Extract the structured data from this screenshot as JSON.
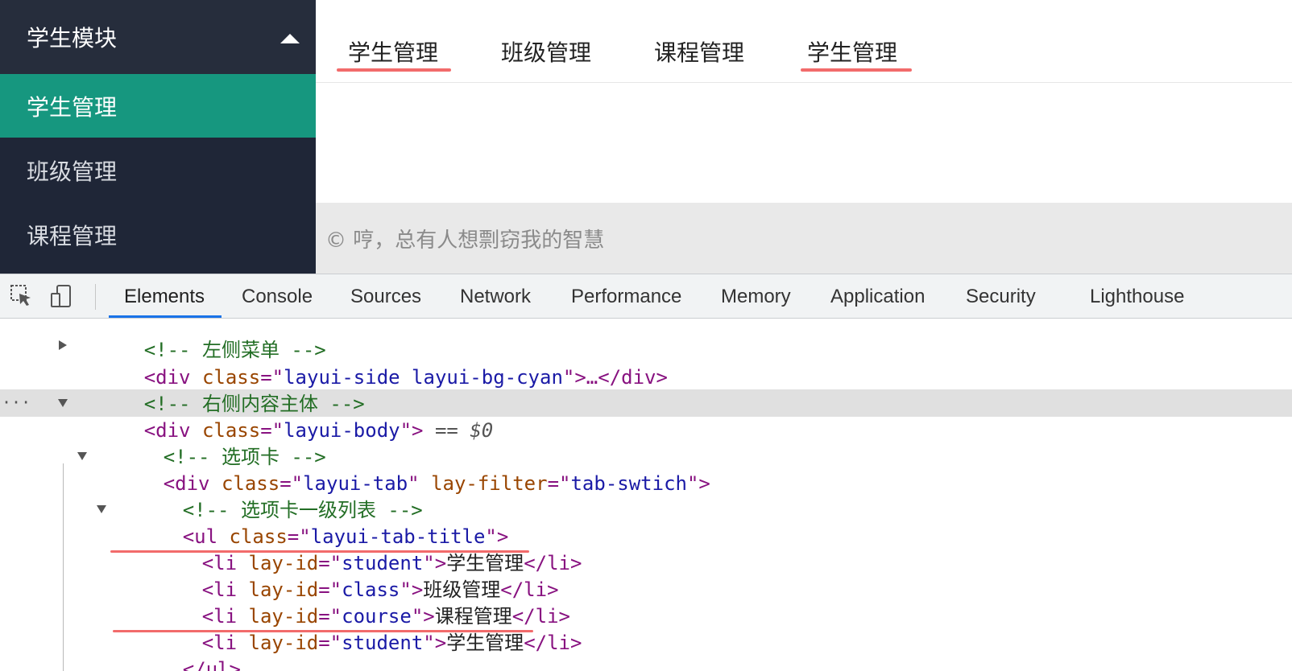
{
  "sidebar": {
    "module_title": "学生模块",
    "items": [
      {
        "label": "学生管理",
        "active": true
      },
      {
        "label": "班级管理",
        "active": false
      },
      {
        "label": "课程管理",
        "active": false
      }
    ]
  },
  "tabs": [
    {
      "label": "学生管理",
      "underlined": true
    },
    {
      "label": "班级管理",
      "underlined": false
    },
    {
      "label": "课程管理",
      "underlined": false
    },
    {
      "label": "学生管理",
      "underlined": true
    }
  ],
  "footer": {
    "text": "© 哼，总有人想剽窃我的智慧"
  },
  "devtools": {
    "tabs": [
      "Elements",
      "Console",
      "Sources",
      "Network",
      "Performance",
      "Memory",
      "Application",
      "Security",
      "Lighthouse"
    ],
    "active_tab": "Elements",
    "code": {
      "l0_comment": "<!-- 左侧菜单 -->",
      "l1_tag_open": "<div",
      "l1_attr": "class",
      "l1_eq": "=\"",
      "l1_val": "layui-side layui-bg-cyan",
      "l1_close": "\">…</div>",
      "l2_comment": "<!-- 右侧内容主体 -->",
      "l3_tag_open": "<div",
      "l3_attr": "class",
      "l3_eq": "=\"",
      "l3_val": "layui-body",
      "l3_close": "\">",
      "l3_marker": " == $0",
      "l4_comment": "<!-- 选项卡 -->",
      "l5_tag_open": "<div",
      "l5_attr1": "class",
      "l5_val1": "layui-tab",
      "l5_attr2": "lay-filter",
      "l5_val2": "tab-swtich",
      "l6_comment": "<!-- 选项卡一级列表 -->",
      "l7_tag_open": "<ul",
      "l7_attr": "class",
      "l7_val": "layui-tab-title",
      "li": [
        {
          "id": "student",
          "text": "学生管理"
        },
        {
          "id": "class",
          "text": "班级管理"
        },
        {
          "id": "course",
          "text": "课程管理"
        },
        {
          "id": "student",
          "text": "学生管理"
        }
      ],
      "li_open": "<li",
      "li_attr": "lay-id",
      "li_close": "</li>",
      "ul_close": "</ul>"
    }
  },
  "colors": {
    "sidebar_bg": "#1f2637",
    "sidebar_active": "#16977f",
    "underline": "#f26b6b",
    "devtools_active": "#1a73e8"
  }
}
